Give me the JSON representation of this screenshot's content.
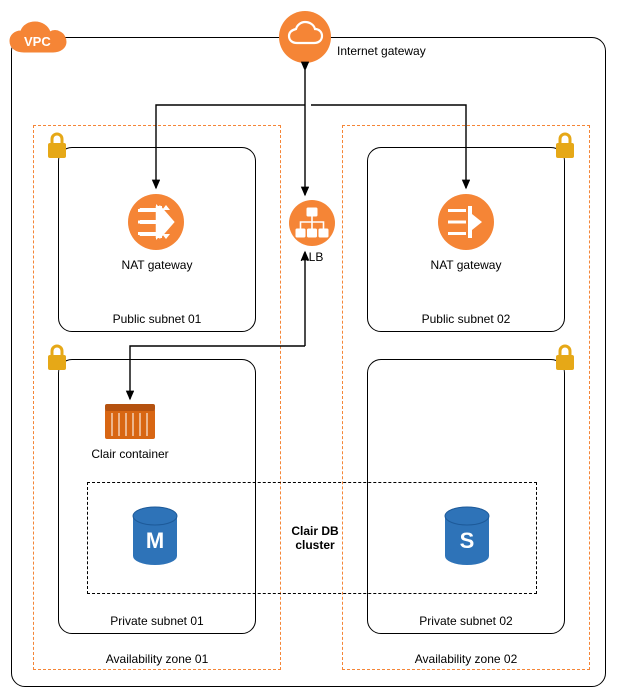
{
  "colors": {
    "aws_orange": "#F58536",
    "db_blue": "#2E73B8",
    "container_orange": "#D86613",
    "lock_gold": "#E6A817"
  },
  "labels": {
    "vpc": "VPC",
    "igw": "Internet gateway",
    "alb": "ALB",
    "nat1": "NAT gateway",
    "nat2": "NAT gateway",
    "pubsub1": "Public subnet 01",
    "pubsub2": "Public subnet 02",
    "privsub1": "Private subnet 01",
    "privsub2": "Private subnet 02",
    "az1": "Availability zone 01",
    "az2": "Availability zone 02",
    "clair_container": "Clair container",
    "clair_db": "Clair DB\ncluster",
    "db_m": "M",
    "db_s": "S"
  }
}
